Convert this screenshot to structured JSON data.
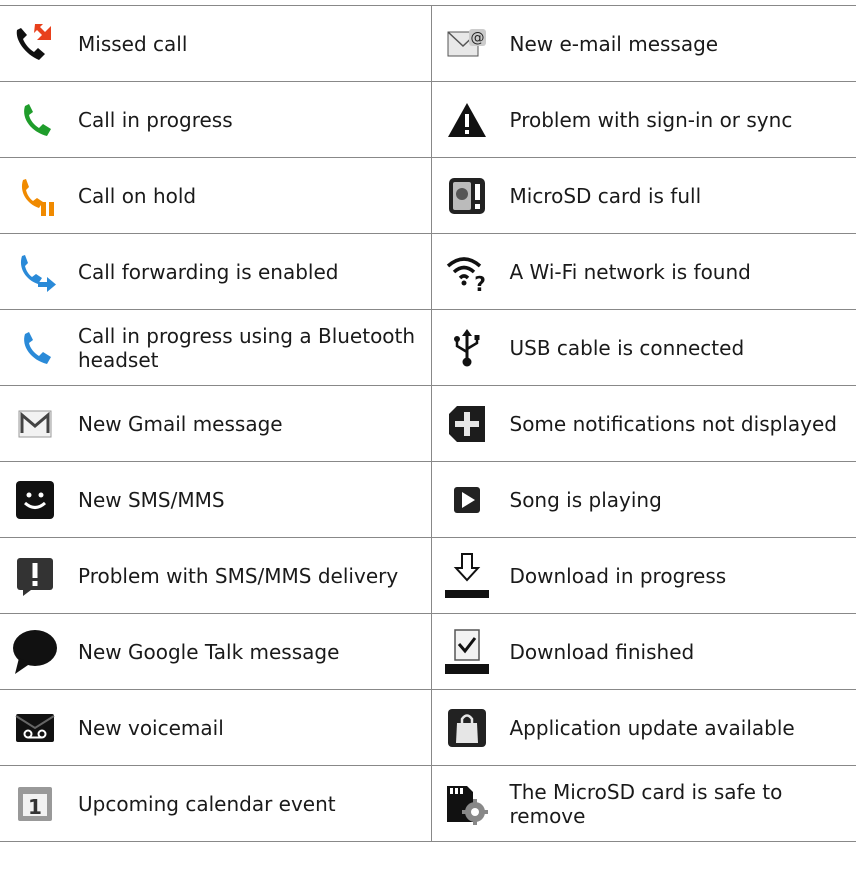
{
  "rows": [
    {
      "left": {
        "icon": "missed-call-icon",
        "label": "Missed call"
      },
      "right": {
        "icon": "email-icon",
        "label": "New e-mail message"
      }
    },
    {
      "left": {
        "icon": "call-in-progress-icon",
        "label": "Call in progress"
      },
      "right": {
        "icon": "warning-icon",
        "label": "Problem with sign-in or sync"
      }
    },
    {
      "left": {
        "icon": "call-on-hold-icon",
        "label": "Call on hold"
      },
      "right": {
        "icon": "sd-card-full-icon",
        "label": "MicroSD card is full"
      }
    },
    {
      "left": {
        "icon": "call-forwarding-icon",
        "label": "Call forwarding is enabled"
      },
      "right": {
        "icon": "wifi-found-icon",
        "label": "A Wi-Fi network is found"
      }
    },
    {
      "left": {
        "icon": "bluetooth-call-icon",
        "label": "Call in progress using a Bluetooth headset"
      },
      "right": {
        "icon": "usb-icon",
        "label": "USB cable is connected"
      }
    },
    {
      "left": {
        "icon": "gmail-icon",
        "label": "New Gmail message"
      },
      "right": {
        "icon": "more-notifications-icon",
        "label": "Some notifications not displayed"
      }
    },
    {
      "left": {
        "icon": "sms-icon",
        "label": "New SMS/MMS"
      },
      "right": {
        "icon": "play-icon",
        "label": "Song is playing"
      }
    },
    {
      "left": {
        "icon": "sms-problem-icon",
        "label": "Problem with SMS/MMS delivery"
      },
      "right": {
        "icon": "download-icon",
        "label": "Download in progress"
      }
    },
    {
      "left": {
        "icon": "talk-icon",
        "label": "New Google Talk message"
      },
      "right": {
        "icon": "download-finished-icon",
        "label": "Download finished"
      }
    },
    {
      "left": {
        "icon": "voicemail-icon",
        "label": "New voicemail"
      },
      "right": {
        "icon": "app-update-icon",
        "label": "Application update available"
      }
    },
    {
      "left": {
        "icon": "calendar-icon",
        "label": "Upcoming calendar event"
      },
      "right": {
        "icon": "sd-safe-remove-icon",
        "label": "The MicroSD card is safe to remove"
      }
    }
  ]
}
